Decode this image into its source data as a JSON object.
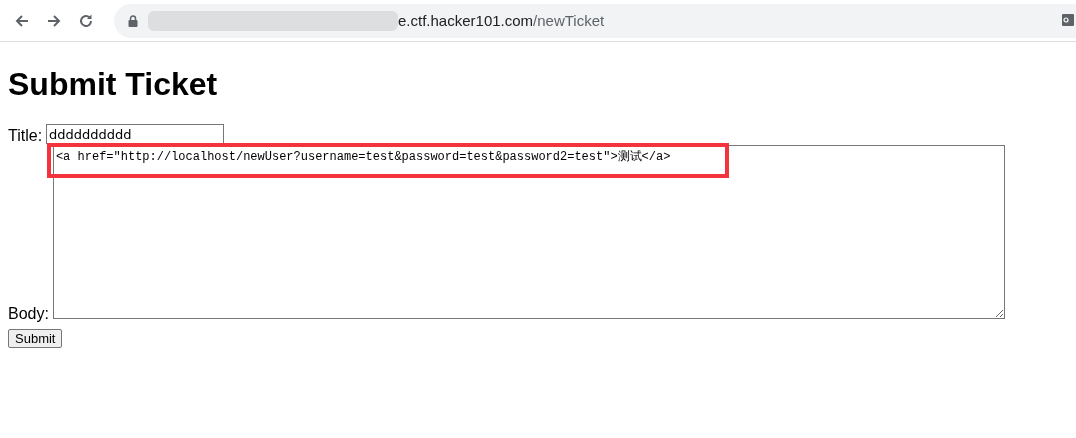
{
  "browser": {
    "url_host": "e.ctf.hacker101.com",
    "url_path": "/newTicket"
  },
  "page": {
    "heading": "Submit Ticket",
    "title_label": "Title:",
    "title_value": "dddddddddd",
    "body_label": "Body:",
    "body_value": "<a href=\"http://localhost/newUser?username=test&password=test&password2=test\">测试</a>",
    "submit": "Submit"
  }
}
